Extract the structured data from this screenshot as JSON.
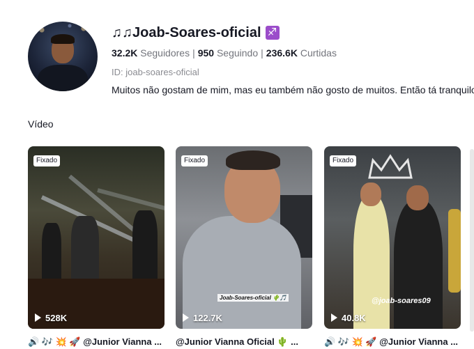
{
  "profile": {
    "username": "♫♫Joab-Soares-oficial",
    "zodiac": "♐",
    "following_count": "950",
    "following_label": "Seguindo",
    "followers_count": "32.2K",
    "followers_label": "Seguidores",
    "likes_count": "236.6K",
    "likes_label": "Curtidas",
    "id_line": "ID: joab-soares-oficial",
    "bio": "Muitos não gostam de mim, mas eu também não gosto de muitos. Então tá tranquilo"
  },
  "section_label": "Vídeo",
  "videos": [
    {
      "badge": "Fixado",
      "views": "528K",
      "caption": "🔊 🎶 💥 🚀 @Junior Vianna ..."
    },
    {
      "badge": "Fixado",
      "views": "122.7K",
      "overlay_tag": "Joab-Soares-oficial 🌵🎵",
      "caption": "@Junior Vianna Oficial 🌵 ..."
    },
    {
      "badge": "Fixado",
      "views": "40.8K",
      "overlay_tag": "@joab-soares09",
      "caption": "🔊 🎶 💥 🚀 @Junior Vianna ..."
    }
  ]
}
